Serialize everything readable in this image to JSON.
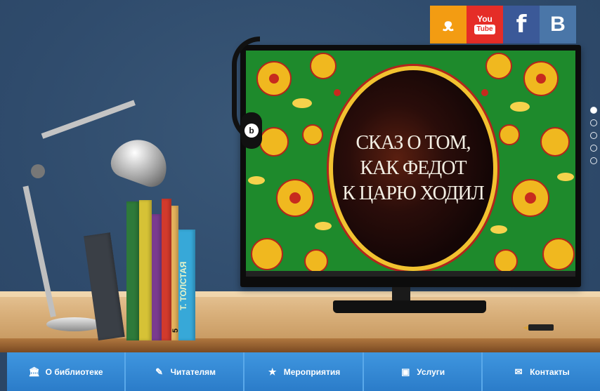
{
  "social": [
    {
      "name": "odnoklassniki",
      "glyph": "ок",
      "color": "#f39c12"
    },
    {
      "name": "youtube",
      "glyph": "You",
      "sub": "Tube",
      "color": "#e52d27"
    },
    {
      "name": "facebook",
      "glyph": "f",
      "color": "#3b5998"
    },
    {
      "name": "vkontakte",
      "glyph": "В",
      "color": "#4a76a8"
    }
  ],
  "slide": {
    "title_lines": [
      "СКАЗ О ТОМ,",
      "КАК ФЕДОТ",
      "К ЦАРЮ ХОДИЛ"
    ],
    "current": 1,
    "total": 5
  },
  "book_spine": {
    "author": "Т. ТОЛСТАЯ",
    "number": "5"
  },
  "nav": [
    {
      "label": "О библиотеке",
      "icon": "bank-icon",
      "glyph": "🏛"
    },
    {
      "label": "Читателям",
      "icon": "book-icon",
      "glyph": "✎"
    },
    {
      "label": "Мероприятия",
      "icon": "star-icon",
      "glyph": "★"
    },
    {
      "label": "Услуги",
      "icon": "briefcase-icon",
      "glyph": "▣"
    },
    {
      "label": "Контакты",
      "icon": "envelope-icon",
      "glyph": "✉"
    }
  ]
}
